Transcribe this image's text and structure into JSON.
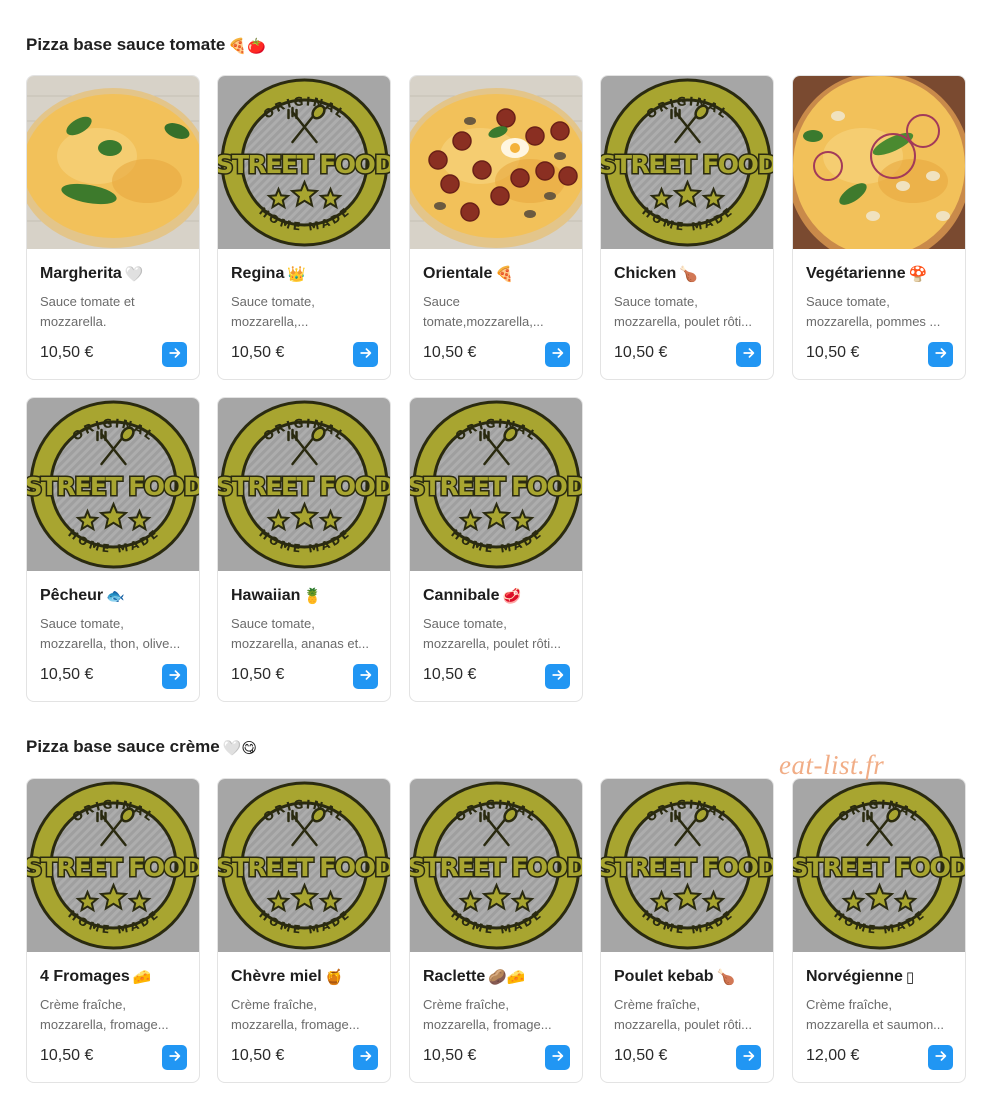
{
  "sections": [
    {
      "title": "Pizza base sauce tomate",
      "title_emoji": "🍕🍅",
      "items": [
        {
          "name": "Margherita",
          "emoji": "🤍",
          "desc": "Sauce tomate et mozzarella.",
          "price": "10,50 €",
          "image": "margherita"
        },
        {
          "name": "Regina",
          "emoji": "👑",
          "desc": "Sauce tomate, mozzarella,...",
          "price": "10,50 €",
          "image": "placeholder"
        },
        {
          "name": "Orientale",
          "emoji": "🍕",
          "desc": "Sauce tomate,mozzarella,...",
          "price": "10,50 €",
          "image": "orientale"
        },
        {
          "name": "Chicken",
          "emoji": "🍗",
          "desc": "Sauce tomate, mozzarella, poulet rôti...",
          "price": "10,50 €",
          "image": "placeholder"
        },
        {
          "name": "Vegétarienne",
          "emoji": "🍄",
          "desc": "Sauce tomate, mozzarella, pommes ...",
          "price": "10,50 €",
          "image": "vegetarienne"
        },
        {
          "name": "Pêcheur",
          "emoji": "🐟",
          "desc": "Sauce tomate, mozzarella, thon, olive...",
          "price": "10,50 €",
          "image": "placeholder"
        },
        {
          "name": "Hawaiian",
          "emoji": "🍍",
          "desc": "Sauce tomate, mozzarella, ananas et...",
          "price": "10,50 €",
          "image": "placeholder"
        },
        {
          "name": "Cannibale",
          "emoji": "🥩",
          "desc": "Sauce tomate, mozzarella, poulet rôti...",
          "price": "10,50 €",
          "image": "placeholder"
        }
      ]
    },
    {
      "title": "Pizza base sauce crème",
      "title_emoji": "🤍😋",
      "items": [
        {
          "name": "4 Fromages",
          "emoji": "🧀",
          "desc": "Crème fraîche, mozzarella, fromage...",
          "price": "10,50 €",
          "image": "placeholder"
        },
        {
          "name": "Chèvre miel",
          "emoji": "🍯",
          "desc": "Crème fraîche, mozzarella, fromage...",
          "price": "10,50 €",
          "image": "placeholder"
        },
        {
          "name": "Raclette",
          "emoji": "🥔🧀",
          "desc": "Crème fraîche, mozzarella, fromage...",
          "price": "10,50 €",
          "image": "placeholder"
        },
        {
          "name": "Poulet kebab",
          "emoji": "🍗",
          "desc": "Crème fraîche, mozzarella, poulet rôti...",
          "price": "10,50 €",
          "image": "placeholder"
        },
        {
          "name": "Norvégienne",
          "emoji": "▯",
          "desc": "Crème fraîche, mozzarella et saumon...",
          "price": "12,00 €",
          "image": "placeholder"
        }
      ]
    }
  ],
  "placeholder_logo": {
    "top_text": "ORIGINAL",
    "main_text": "STREET FOOD",
    "bottom_text": "HOME MADE"
  },
  "watermark": "eat-list.fr",
  "icons": {
    "add_button": "arrow-right-icon",
    "logo_icon": "fork-spoon-icon"
  },
  "colors": {
    "accent": "#2196f3",
    "logo_olive": "#a8a530",
    "logo_dark": "#2a2a10",
    "placeholder_bg": "#a6a6a6"
  }
}
